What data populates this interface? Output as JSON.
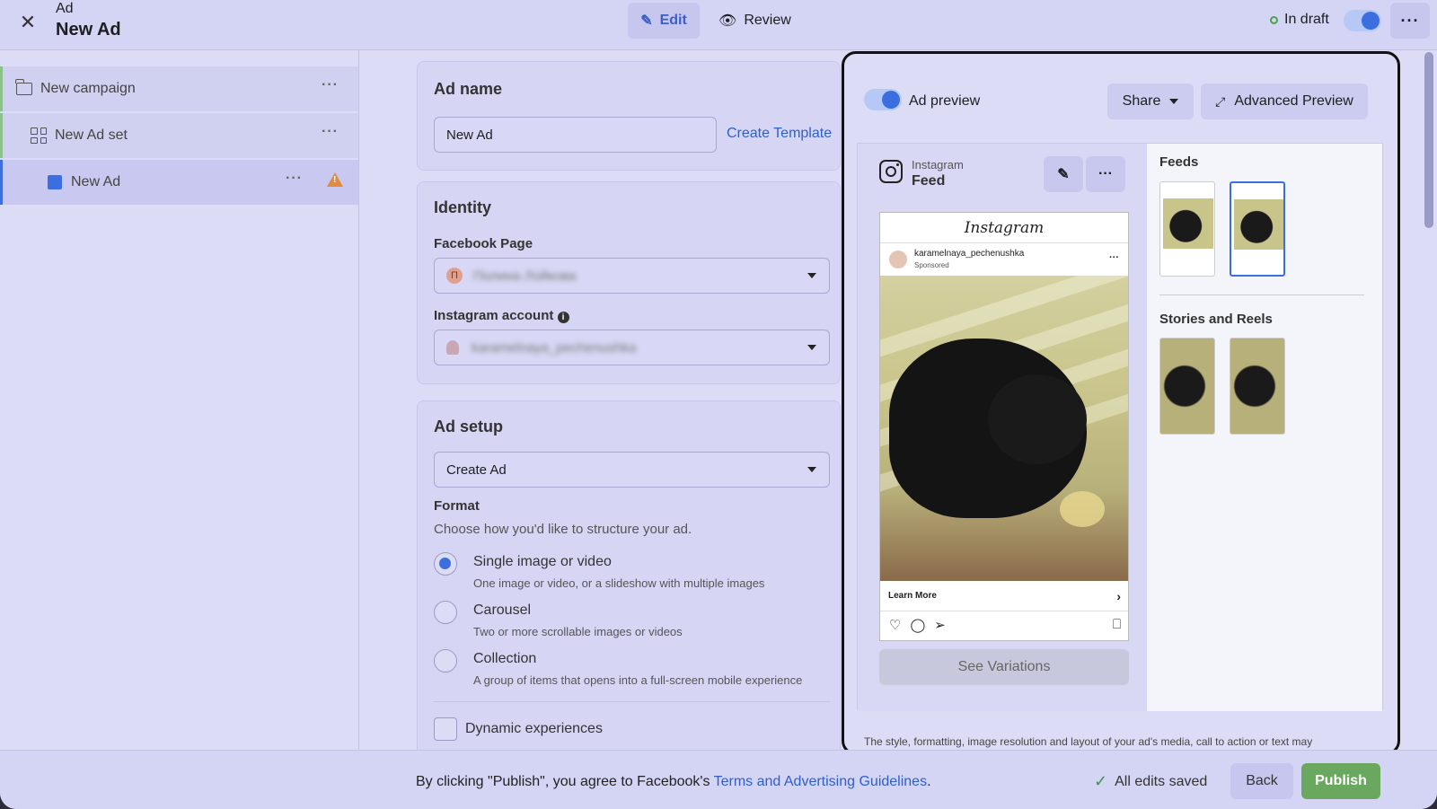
{
  "header": {
    "crumb_small": "Ad",
    "title": "New Ad",
    "edit_label": "Edit",
    "review_label": "Review",
    "status_label": "In draft",
    "status_toggle_on": true
  },
  "tree": {
    "campaign": "New campaign",
    "adset": "New Ad set",
    "ad": "New Ad"
  },
  "ad_name": {
    "heading": "Ad name",
    "value": "New Ad",
    "create_template": "Create Template"
  },
  "identity": {
    "heading": "Identity",
    "facebook_page_label": "Facebook Page",
    "facebook_page_value": "Полина Лойкова",
    "facebook_page_avatar": "П",
    "instagram_label": "Instagram account",
    "instagram_value": "karamelnaya_pechenushka"
  },
  "ad_setup": {
    "heading": "Ad setup",
    "select_value": "Create Ad",
    "format_label": "Format",
    "format_desc": "Choose how you'd like to structure your ad.",
    "options": [
      {
        "title": "Single image or video",
        "sub": "One image or video, or a slideshow with multiple images",
        "selected": true
      },
      {
        "title": "Carousel",
        "sub": "Two or more scrollable images or videos",
        "selected": false
      },
      {
        "title": "Collection",
        "sub": "A group of items that opens into a full-screen mobile experience",
        "selected": false
      }
    ],
    "dynamic_label": "Dynamic experiences"
  },
  "preview": {
    "toggle_label": "Ad preview",
    "toggle_on": true,
    "share_label": "Share",
    "advanced_label": "Advanced Preview",
    "platform": "Instagram",
    "placement": "Feed",
    "app_title": "Instagram",
    "account": "karamelnaya_pechenushka",
    "sponsored": "Sponsored",
    "cta": "Learn More",
    "see_variations": "See Variations",
    "feeds_title": "Feeds",
    "stories_title": "Stories and Reels",
    "note": "The style, formatting, image resolution and layout of your ad's media, call to action or text may"
  },
  "footer": {
    "text_prefix": "By clicking \"Publish\", you agree to Facebook's ",
    "link": "Terms and Advertising Guidelines",
    "text_suffix": ".",
    "saved": "All edits saved",
    "back": "Back",
    "publish": "Publish"
  }
}
